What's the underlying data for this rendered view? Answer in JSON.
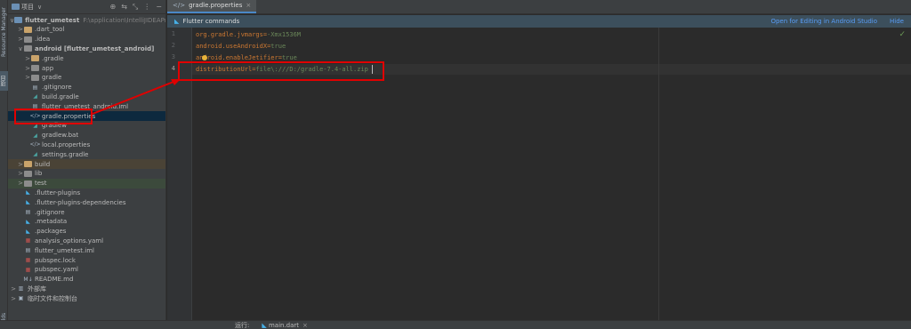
{
  "left_stripe": {
    "tabs": [
      "Resource Manager",
      "项目",
      "Builds"
    ]
  },
  "project": {
    "title": "项目",
    "tools": [
      "⊕",
      "⇆",
      "⤡",
      "⋮",
      "−"
    ],
    "tree": [
      {
        "label": "flutter_umetest",
        "path": "F:\\application\\IntelliJIDEAProj",
        "arrow": "∨",
        "icon": "folder-blue",
        "bold": true
      },
      {
        "label": ".dart_tool",
        "arrow": ">",
        "icon": "folder-orange"
      },
      {
        "label": ".idea",
        "arrow": ">",
        "icon": "folder"
      },
      {
        "label": "android [flutter_umetest_android]",
        "arrow": "∨",
        "icon": "folder",
        "bold": true
      },
      {
        "label": ".gradle",
        "arrow": ">",
        "icon": "folder-orange"
      },
      {
        "label": "app",
        "arrow": ">",
        "icon": "folder"
      },
      {
        "label": "gradle",
        "arrow": ">",
        "icon": "folder"
      },
      {
        "label": ".gitignore",
        "icon": "file"
      },
      {
        "label": "build.gradle",
        "icon": "gradle"
      },
      {
        "label": "flutter_umetest_android.iml",
        "icon": "file"
      },
      {
        "label": "gradle.properties",
        "icon": "props",
        "selected": true
      },
      {
        "label": "gradlew",
        "icon": "gradle"
      },
      {
        "label": "gradlew.bat",
        "icon": "gradle"
      },
      {
        "label": "local.properties",
        "icon": "props"
      },
      {
        "label": "settings.gradle",
        "icon": "gradle"
      },
      {
        "label": "build",
        "arrow": ">",
        "icon": "folder-orange"
      },
      {
        "label": "lib",
        "arrow": ">",
        "icon": "folder"
      },
      {
        "label": "test",
        "arrow": ">",
        "icon": "folder"
      },
      {
        "label": ".flutter-plugins",
        "icon": "flutter"
      },
      {
        "label": ".flutter-plugins-dependencies",
        "icon": "flutter"
      },
      {
        "label": ".gitignore",
        "icon": "file"
      },
      {
        "label": ".metadata",
        "icon": "flutter"
      },
      {
        "label": ".packages",
        "icon": "flutter"
      },
      {
        "label": "analysis_options.yaml",
        "icon": "yaml"
      },
      {
        "label": "flutter_umetest.iml",
        "icon": "file"
      },
      {
        "label": "pubspec.lock",
        "icon": "red"
      },
      {
        "label": "pubspec.yaml",
        "icon": "red"
      },
      {
        "label": "README.md",
        "icon": "md"
      },
      {
        "label": "外部库",
        "arrow": ">",
        "icon": "lib"
      },
      {
        "label": "临时文件和控制台",
        "arrow": ">",
        "icon": "console"
      }
    ]
  },
  "editor": {
    "tab_label": "gradle.properties",
    "tab_close": "×",
    "banner": {
      "link": "Flutter commands",
      "open_android": "Open for Editing in Android Studio",
      "hide": "Hide"
    },
    "check": "✓",
    "lines": [
      {
        "num": "1",
        "key": "org.gradle.jvmargs",
        "eq": "=",
        "value": "-Xmx1536M"
      },
      {
        "num": "2",
        "key": "android.useAndroidX",
        "eq": "=",
        "value": "true"
      },
      {
        "num": "3",
        "key": "android.enableJetifier",
        "eq": "=",
        "value": "true"
      },
      {
        "num": "4",
        "key": "distributionUrl",
        "eq": "=",
        "value": "file\\:///D:/gradle-7.4-all.zip"
      }
    ]
  },
  "bottom": {
    "run_label": "运行:",
    "file_label": "main.dart",
    "close": "×"
  }
}
